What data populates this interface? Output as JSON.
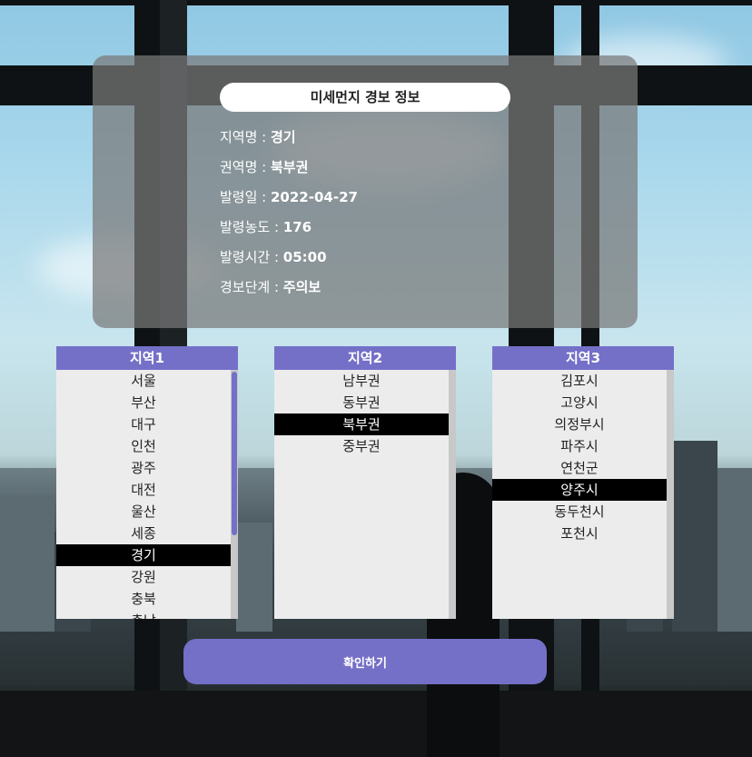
{
  "card": {
    "title": "미세먼지 경보 정보",
    "rows": [
      {
        "label": "지역명 : ",
        "value": "경기"
      },
      {
        "label": "권역명 : ",
        "value": "북부권"
      },
      {
        "label": "발령일 : ",
        "value": "2022-04-27"
      },
      {
        "label": "발령농도 : ",
        "value": "176"
      },
      {
        "label": "발령시간 : ",
        "value": "05:00"
      },
      {
        "label": "경보단계 : ",
        "value": "주의보"
      }
    ]
  },
  "lists": [
    {
      "header": "지역1",
      "items": [
        "서울",
        "부산",
        "대구",
        "인천",
        "광주",
        "대전",
        "울산",
        "세종",
        "경기",
        "강원",
        "충북",
        "충남"
      ],
      "selected": "경기"
    },
    {
      "header": "지역2",
      "items": [
        "남부권",
        "동부권",
        "북부권",
        "중부권"
      ],
      "selected": "북부권"
    },
    {
      "header": "지역3",
      "items": [
        "김포시",
        "고양시",
        "의정부시",
        "파주시",
        "연천군",
        "양주시",
        "동두천시",
        "포천시"
      ],
      "selected": "양주시"
    }
  ],
  "confirm_button": "확인하기",
  "colors": {
    "accent": "#7470c8",
    "selected_bg": "#000000",
    "list_bg": "#ececec"
  }
}
